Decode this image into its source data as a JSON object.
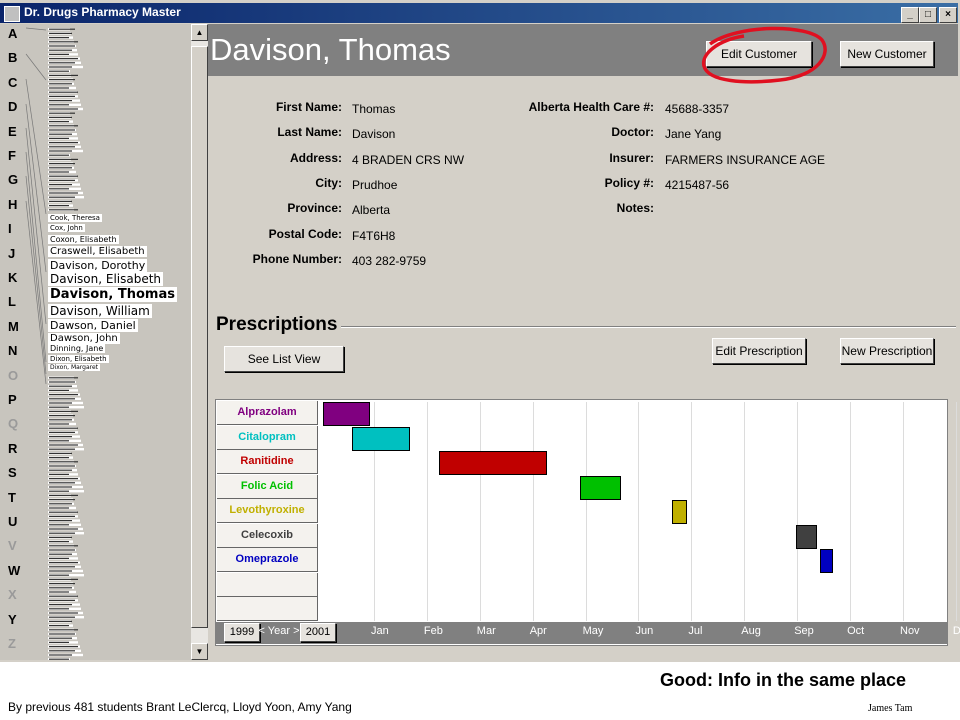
{
  "window": {
    "title": "Dr. Drugs Pharmacy Master",
    "controls": [
      "_",
      "□",
      "×"
    ]
  },
  "sidebar": {
    "letters": [
      {
        "l": "A",
        "dim": false
      },
      {
        "l": "B",
        "dim": false
      },
      {
        "l": "C",
        "dim": false
      },
      {
        "l": "D",
        "dim": false
      },
      {
        "l": "E",
        "dim": false
      },
      {
        "l": "F",
        "dim": false
      },
      {
        "l": "G",
        "dim": false
      },
      {
        "l": "H",
        "dim": false
      },
      {
        "l": "I",
        "dim": false
      },
      {
        "l": "J",
        "dim": false
      },
      {
        "l": "K",
        "dim": false
      },
      {
        "l": "L",
        "dim": false
      },
      {
        "l": "M",
        "dim": false
      },
      {
        "l": "N",
        "dim": false
      },
      {
        "l": "O",
        "dim": true
      },
      {
        "l": "P",
        "dim": false
      },
      {
        "l": "Q",
        "dim": true
      },
      {
        "l": "R",
        "dim": false
      },
      {
        "l": "S",
        "dim": false
      },
      {
        "l": "T",
        "dim": false
      },
      {
        "l": "U",
        "dim": false
      },
      {
        "l": "V",
        "dim": true
      },
      {
        "l": "W",
        "dim": false
      },
      {
        "l": "X",
        "dim": true
      },
      {
        "l": "Y",
        "dim": false
      },
      {
        "l": "Z",
        "dim": true
      }
    ],
    "names": [
      "Cook, Theresa",
      "Cox, John",
      "Coxon, Elisabeth",
      "Craswell, Elisabeth",
      "Davison, Dorothy",
      "Davison, Elisabeth",
      "Davison, Thomas",
      "Davison, William",
      "Dawson, Daniel",
      "Dawson, John",
      "Dinning, Jane",
      "Dixon, Elisabeth",
      "Dixon, Margaret"
    ]
  },
  "customer": {
    "name": "Davison, Thomas",
    "edit_label": "Edit Customer",
    "new_label": "New Customer",
    "fields_left": [
      {
        "label": "First Name:",
        "value": "Thomas"
      },
      {
        "label": "Last Name:",
        "value": "Davison"
      },
      {
        "label": "Address:",
        "value": "4 BRADEN CRS NW"
      },
      {
        "label": "City:",
        "value": "Prudhoe"
      },
      {
        "label": "Province:",
        "value": "Alberta"
      },
      {
        "label": "Postal Code:",
        "value": "F4T6H8"
      },
      {
        "label": "Phone Number:",
        "value": "403     282-9759"
      }
    ],
    "fields_right": [
      {
        "label": "Alberta Health Care #:",
        "value": "45688-3357"
      },
      {
        "label": "Doctor:",
        "value": "Jane Yang"
      },
      {
        "label": "Insurer:",
        "value": "FARMERS INSURANCE AGE"
      },
      {
        "label": "Policy #:",
        "value": "4215487-56"
      },
      {
        "label": "Notes:",
        "value": ""
      }
    ]
  },
  "prescriptions": {
    "title": "Prescriptions",
    "list_view_label": "See List View",
    "edit_label": "Edit Prescription",
    "new_label": "New Prescription",
    "year_prev": "1999",
    "year_label": "< Year >",
    "year_next": "2001",
    "months": [
      "Jan",
      "Feb",
      "Mar",
      "Apr",
      "May",
      "Jun",
      "Jul",
      "Aug",
      "Sep",
      "Oct",
      "Nov",
      "Dec"
    ]
  },
  "chart_data": {
    "type": "gantt",
    "time_axis": [
      "Jan",
      "Feb",
      "Mar",
      "Apr",
      "May",
      "Jun",
      "Jul",
      "Aug",
      "Sep",
      "Oct",
      "Nov",
      "Dec"
    ],
    "series": [
      {
        "name": "Alprazolam",
        "color": "#800080",
        "start": 0.0,
        "end": 0.85
      },
      {
        "name": "Citalopram",
        "color": "#00c0c0",
        "start": 0.55,
        "end": 1.6
      },
      {
        "name": "Ranitidine",
        "color": "#c00000",
        "start": 2.2,
        "end": 4.2
      },
      {
        "name": "Folic Acid",
        "color": "#00c000",
        "start": 4.85,
        "end": 5.6
      },
      {
        "name": "Levothyroxine",
        "color": "#c0b000",
        "start": 6.6,
        "end": 6.85
      },
      {
        "name": "Celecoxib",
        "color": "#404040",
        "start": 8.95,
        "end": 9.3
      },
      {
        "name": "Omeprazole",
        "color": "#0000c0",
        "start": 9.4,
        "end": 9.6
      }
    ]
  },
  "footer": {
    "good": "Good: Info in the same place",
    "credit": "By previous 481 students Brant LeClercq, Lloyd Yoon, Amy Yang",
    "author": "James Tam"
  }
}
